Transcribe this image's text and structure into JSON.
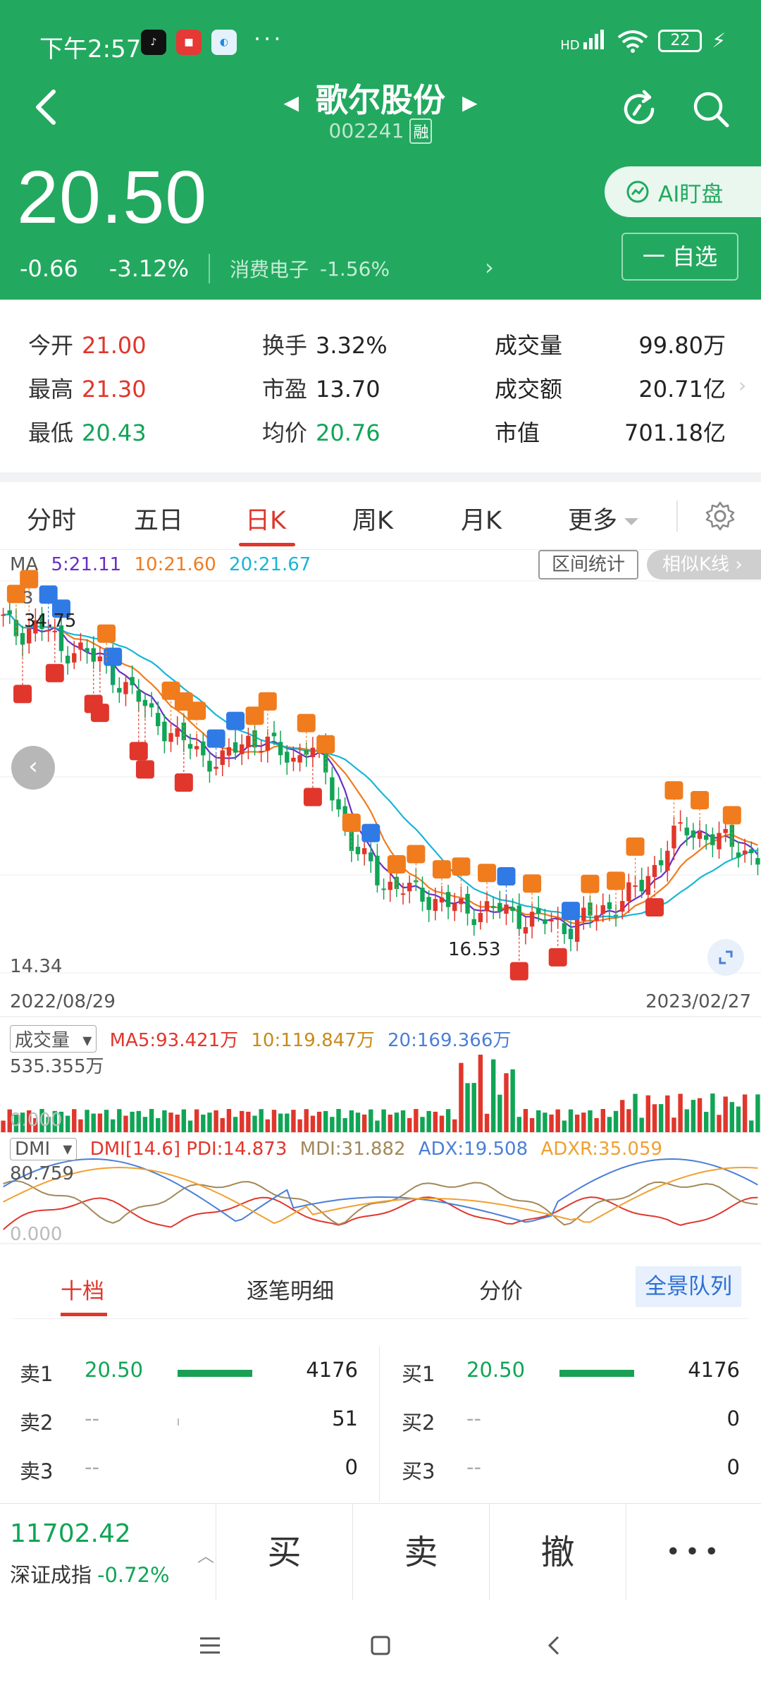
{
  "status": {
    "time": "下午2:57",
    "more": "···",
    "network": "HD",
    "battery": "22"
  },
  "header": {
    "stock_name": "歌尔股份",
    "stock_code": "002241",
    "margin_tag": "融",
    "price": "20.50",
    "change": "-0.66",
    "change_pct": "-3.12%",
    "sector_name": "消费电子",
    "sector_pct": "-1.56%",
    "ai_button": "AI盯盘",
    "watch_button": "一 自选"
  },
  "quote": {
    "open_label": "今开",
    "open": "21.00",
    "high_label": "最高",
    "high": "21.30",
    "low_label": "最低",
    "low": "20.43",
    "turnover_label": "换手",
    "turnover": "3.32%",
    "pe_label": "市盈",
    "pe": "13.70",
    "avg_label": "均价",
    "avg": "20.76",
    "volume_label": "成交量",
    "volume": "99.80万",
    "amount_label": "成交额",
    "amount": "20.71亿",
    "mcap_label": "市值",
    "mcap": "701.18亿"
  },
  "tabs": {
    "intraday": "分时",
    "five_day": "五日",
    "daily": "日K",
    "weekly": "周K",
    "monthly": "月K",
    "more": "更多"
  },
  "chart": {
    "ma_label": "MA",
    "ma5": "5:21.11",
    "ma10": "10:21.60",
    "ma20": "20:21.67",
    "range_button": "区间统计",
    "similar_button": "相似K线",
    "high_marker": "34.75",
    "low_marker": "16.53",
    "y_top_clip": "3",
    "y_min": "14.34",
    "date_start": "2022/08/29",
    "date_end": "2023/02/27",
    "vol_selector": "成交量",
    "vol_ma5": "MA5:93.421万",
    "vol_ma10": "10:119.847万",
    "vol_ma20": "20:169.366万",
    "vol_max": "535.355万",
    "vol_zero": "0.000",
    "dmi_selector": "DMI",
    "dmi_pdi": "DMI[14.6] PDI:14.873",
    "dmi_mdi": "MDI:31.882",
    "dmi_adx": "ADX:19.508",
    "dmi_adxr": "ADXR:35.059",
    "dmi_max": "80.759",
    "dmi_zero": "0.000",
    "colors": {
      "ma5": "#6a2ec6",
      "ma10": "#f07c1e",
      "ma20": "#18b6d6",
      "up": "#e0362c",
      "down": "#10a556"
    }
  },
  "chart_data": {
    "type": "candlestick",
    "x_range": [
      "2022/08/29",
      "2023/02/27"
    ],
    "price_high": 34.75,
    "price_low": 16.53,
    "axis_min": 14.34,
    "volume_axis_max": "535.355万",
    "dmi_axis_max": 80.759,
    "close_trend": [
      33.2,
      32.5,
      33.0,
      32.8,
      31.5,
      31.9,
      31.2,
      30.8,
      30.0,
      29.2,
      28.4,
      27.6,
      26.8,
      26.5,
      25.9,
      25.5,
      26.4,
      27.0,
      26.6,
      26.2,
      25.8,
      26.6,
      25.4,
      23.5,
      21.2,
      20.2,
      19.4,
      18.9,
      18.7,
      18.5,
      18.2,
      17.9,
      17.6,
      17.8,
      17.7,
      17.5,
      17.3,
      17.1,
      17.0,
      16.8,
      17.2,
      17.6,
      18.0,
      18.4,
      19.0,
      20.2,
      21.5,
      22.0,
      21.8,
      21.6,
      21.2,
      21.0,
      20.5
    ]
  },
  "book": {
    "tab_ten": "十档",
    "tab_ticks": "逐笔明细",
    "tab_price": "分价",
    "tab_queue": "全景队列",
    "sell": [
      {
        "label": "卖1",
        "price": "20.50",
        "volume": "4176",
        "ratio": 1.0
      },
      {
        "label": "卖2",
        "price": "--",
        "volume": "51",
        "ratio": 0.012
      },
      {
        "label": "卖3",
        "price": "--",
        "volume": "0",
        "ratio": 0
      }
    ],
    "buy": [
      {
        "label": "买1",
        "price": "20.50",
        "volume": "4176",
        "ratio": 1.0
      },
      {
        "label": "买2",
        "price": "--",
        "volume": "0",
        "ratio": 0
      },
      {
        "label": "买3",
        "price": "--",
        "volume": "0",
        "ratio": 0
      }
    ]
  },
  "trade": {
    "index_value": "11702.42",
    "index_name": "深证成指",
    "index_pct": "-0.72%",
    "buy": "买",
    "sell": "卖",
    "cancel": "撤",
    "more": "•••"
  }
}
